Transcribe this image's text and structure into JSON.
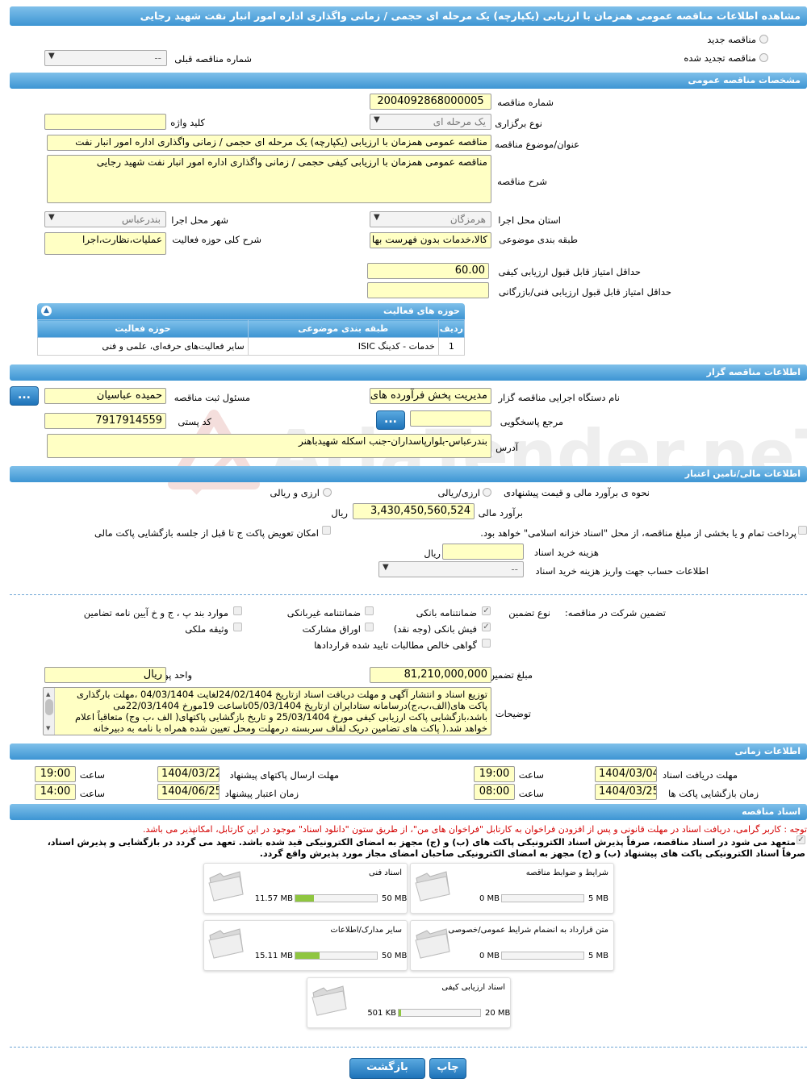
{
  "header": {
    "title": "مشاهده اطلاعات مناقصه عمومی همزمان با ارزیابی (یکپارچه) یک مرحله ای حجمی / زمانی واگذاری اداره امور انبار نفت شهید رجایی"
  },
  "tender_type": {
    "new_label": "مناقصه جدید",
    "renewed_label": "مناقصه تجدید شده",
    "prev_number_label": "شماره مناقصه قبلی",
    "prev_number_value": "--"
  },
  "general": {
    "section_title": "مشخصات مناقصه عمومی",
    "number_label": "شماره مناقصه",
    "number_value": "2004092868000005",
    "type_label": "نوع برگزاری",
    "type_value": "یک مرحله ای",
    "keyword_label": "کلید واژه",
    "keyword_value": "",
    "subject_label": "عنوان/موضوع مناقصه",
    "subject_value": "مناقصه عمومی همزمان با ارزیابی (یکپارچه) یک مرحله ای حجمی / زمانی واگذاری اداره امور انبار نفت",
    "desc_label": "شرح مناقصه",
    "desc_value": "مناقصه عمومی همزمان با ارزیابی کیفی حجمی / زمانی واگذاری اداره امور انبار نفت شهید رجایی",
    "province_label": "استان محل اجرا",
    "province_value": "هرمزگان",
    "city_label": "شهر محل اجرا",
    "city_value": "بندرعباس",
    "category_label": "طبقه بندی موضوعی",
    "category_value": "کالا،خدمات بدون فهرست بها",
    "scope_label": "شرح کلی حوزه فعالیت",
    "scope_value": "عملیات،نظارت،اجرا",
    "min_quality_label": "حداقل امتیاز قابل قبول ارزیابی کیفی",
    "min_quality_value": "60.00",
    "min_tech_label": "حداقل امتیاز قابل قبول ارزیابی فنی/بازرگانی",
    "min_tech_value": ""
  },
  "activities": {
    "title": "حوزه های فعالیت",
    "columns": [
      "ردیف",
      "طبقه بندی موضوعی",
      "حوزه فعالیت"
    ],
    "rows": [
      {
        "index": "1",
        "category": "خدمات - کدینگ ISIC",
        "field": "سایر فعالیت‌های حرفه‌ای، علمی و فنی"
      }
    ]
  },
  "organizer": {
    "section_title": "اطلاعات مناقصه گزار",
    "org_label": "نام دستگاه اجرایی مناقصه گزار",
    "org_value": "مدیریت پخش فرآورده های نفتی",
    "officer_label": "مسئول ثبت مناقصه",
    "officer_value": "حمیده عباسیان",
    "ref_label": "مرجع پاسخگویی",
    "ref_value": "",
    "postal_label": "کد پستی",
    "postal_value": "7917914559",
    "address_label": "آدرس",
    "address_value": "بندرعباس-بلوارپاسداران-جنب اسکله شهیدباهنر",
    "more_btn": "..."
  },
  "finance": {
    "section_title": "اطلاعات مالی/تامین اعتبار",
    "method_label": "نحوه ی برآورد مالی و قیمت پیشنهادی",
    "rial_opt": "ارزی/ریالی",
    "currency_opt": "ارزی و ریالی",
    "estimate_label": "برآورد مالی",
    "estimate_value": "3,430,450,560,524",
    "rial": "ریال",
    "treasury_text": "پرداخت تمام و یا بخشی از مبلغ مناقصه، از محل \"اسناد خزانه اسلامی\" خواهد بود.",
    "swap_text": "امکان تعویض پاکت ج تا قبل از جلسه بازگشایی پاکت مالی",
    "doc_cost_label": "هزینه خرید اسناد",
    "doc_cost_value": "",
    "account_label": "اطلاعات حساب جهت واریز هزینه خرید اسناد",
    "account_value": "--"
  },
  "guarantee": {
    "title_label": "تضمین شرکت در مناقصه:",
    "type_label": "نوع تضمین",
    "opt_bank": "ضمانتنامه بانکی",
    "opt_nonbank": "ضمانتنامه غیربانکی",
    "opt_bjh": "موارد بند پ ، ج و خ آیین نامه تضامین",
    "opt_receipt": "فیش بانکی (وجه نقد)",
    "opt_shares": "اوراق مشارکت",
    "opt_property": "وثیقه ملکی",
    "opt_claims": "گواهی خالص مطالبات تایید شده قراردادها",
    "amount_label": "مبلغ تضمین",
    "amount_value": "81,210,000,000",
    "unit_label": "واحد پول",
    "unit_value": "ریال",
    "notes_label": "توضیحات",
    "notes_value": "توزیع اسناد و انتشار آگهی و مهلت دریافت اسناد ازتاریخ 24/02/1404لغایت 04/03/1404 ،مهلت بارگذاری پاکت های(الف،ب،ج)درسامانه ستادایران ازتاریخ 05/03/1404تاساعت 19مورخ 22/03/1404می باشد،بازگشایی پاکت ارزیابی کیفی مورخ 25/03/1404 و تاریخ بازگشایی پاکتهای( الف ،ب وج) متعاقباً اعلام خواهد شد.( پاکت های تضامین دریک لفاف سربسته درمهلت ومحل تعیین شده همراه با نامه به دبیرخانه"
  },
  "timing": {
    "section_title": "اطلاعات زمانی",
    "doc_deadline_label": "مهلت دریافت اسناد",
    "doc_deadline_date": "1404/03/04",
    "doc_deadline_time": "19:00",
    "send_deadline_label": "مهلت ارسال پاکتهای پیشنهاد",
    "send_deadline_date": "1404/03/22",
    "send_deadline_time": "19:00",
    "open_label": "زمان بازگشایی پاکت ها",
    "open_date": "1404/03/25",
    "open_time": "08:00",
    "validity_label": "زمان اعتبار پیشنهاد",
    "validity_date": "1404/06/25",
    "validity_time": "14:00",
    "time_label": "ساعت"
  },
  "documents": {
    "section_title": "اسناد مناقصه",
    "notice": "توجه : کاربر گرامی، دریافت اسناد در مهلت قانونی و پس از افزودن فراخوان به کارتابل \"فراخوان های من\"، از طریق ستون \"دانلود اسناد\" موجود در این کارتابل، امکانپذیر می باشد.",
    "commit1": "متعهد می شود در اسناد مناقصه، صرفاً پذیرش اسناد الکترونیکی پاکت های (ب) و (ج) مجهز به امضای الکترونیکی قید شده باشد. تعهد می گردد در بازگشایی و پذیرش اسناد،",
    "commit2": "صرفاً اسناد الکترونیکی پاکت های پیشنهاد (ب) و (ج) مجهز به امضای الکترونیکی صاحبان امضای مجاز مورد پذیرش واقع گردد.",
    "items": [
      {
        "name": "شرایط و ضوابط مناقصه",
        "used": "0 MB",
        "max": "5 MB",
        "fill": 0.0
      },
      {
        "name": "اسناد فنی",
        "used": "11.57 MB",
        "max": "50 MB",
        "fill": 0.23
      },
      {
        "name": "متن قرارداد به انضمام شرایط عمومی/خصوصی",
        "used": "0 MB",
        "max": "5 MB",
        "fill": 0.0
      },
      {
        "name": "سایر مدارک/اطلاعات",
        "used": "15.11 MB",
        "max": "50 MB",
        "fill": 0.3
      },
      {
        "name": "اسناد ارزیابی کیفی",
        "used": "501 KB",
        "max": "20 MB",
        "fill": 0.025
      }
    ]
  },
  "footer": {
    "print_label": "چاپ",
    "back_label": "بازگشت"
  },
  "watermark": {
    "text": "AriaTender.neT"
  }
}
